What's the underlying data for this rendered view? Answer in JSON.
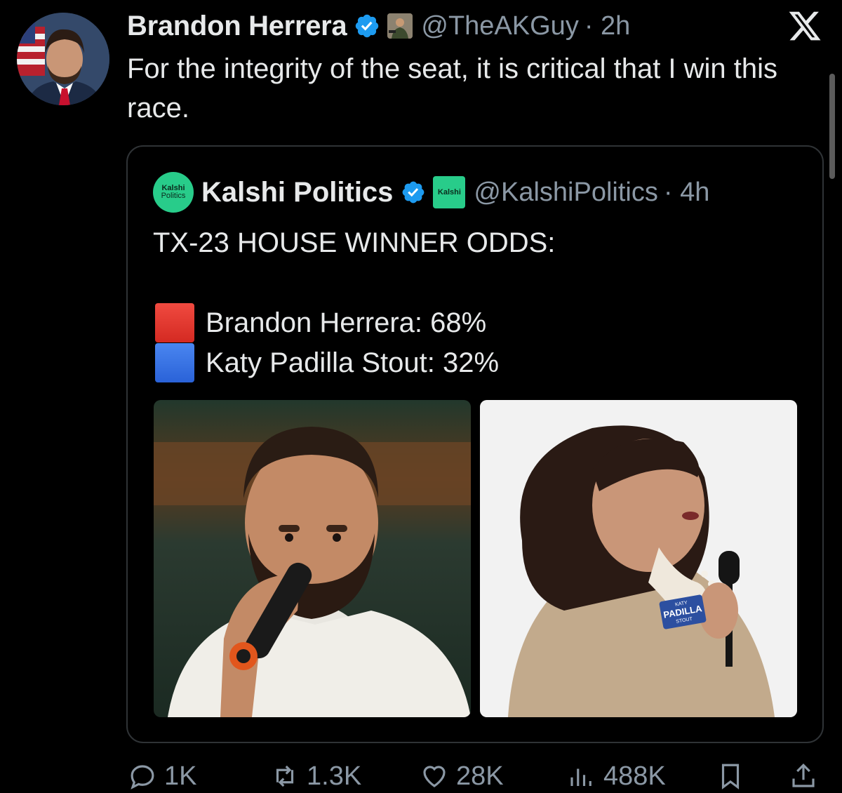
{
  "tweet": {
    "author_name": "Brandon Herrera",
    "handle": "@TheAKGuy",
    "time": "· 2h",
    "text": "For the integrity of the seat, it is critical that I win this race."
  },
  "quote": {
    "author_name": "Kalshi Politics",
    "avatar_text_1": "Kalshi",
    "avatar_text_2": "Politics",
    "badge_text": "Kalshi",
    "handle": "@KalshiPolitics",
    "time": "· 4h",
    "title": "TX-23 HOUSE WINNER ODDS:",
    "odds": [
      {
        "label": "Brandon Herrera: 68%",
        "color": "#e3322b"
      },
      {
        "label": "Katy Padilla Stout: 32%",
        "color": "#2f6fe4"
      }
    ],
    "photos": [
      {
        "subject": "Brandon Herrera speaking into microphone"
      },
      {
        "subject": "Katy Padilla Stout speaking into microphone",
        "sticker_line_1": "KATY",
        "sticker_line_2": "PADILLA",
        "sticker_line_3": "STOUT"
      }
    ]
  },
  "actions": {
    "replies": "1K",
    "reposts": "1.3K",
    "likes": "28K",
    "views": "488K"
  },
  "colors": {
    "background": "#000000",
    "text": "#e7e9ea",
    "muted": "#8b98a5",
    "verified": "#1d9bf0",
    "kalshi_green": "#28cc8a"
  }
}
